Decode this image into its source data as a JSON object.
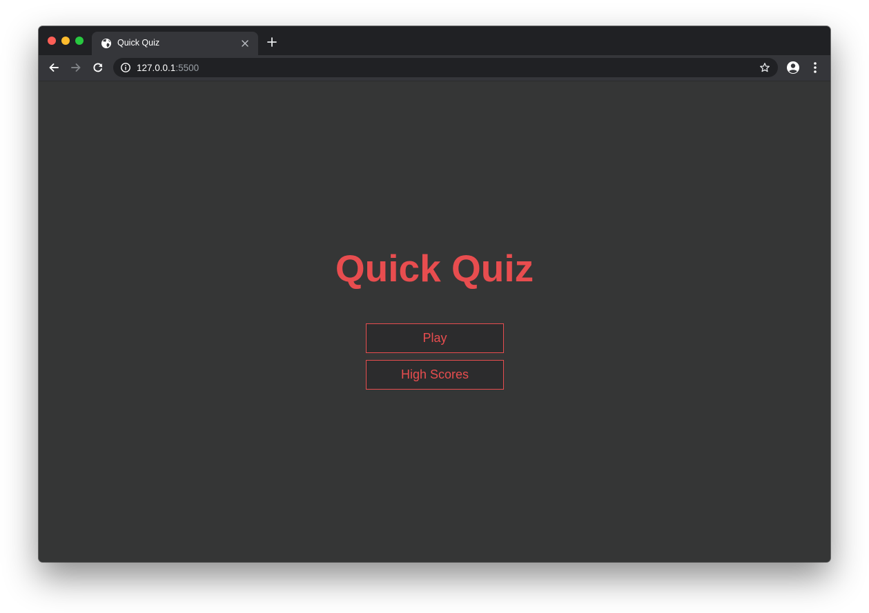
{
  "browser": {
    "tab": {
      "title": "Quick Quiz",
      "favicon": "globe-icon",
      "close_icon": "close-icon"
    },
    "new_tab_icon": "plus-icon",
    "toolbar": {
      "back_icon": "back-arrow-icon",
      "forward_icon": "forward-arrow-icon",
      "reload_icon": "reload-icon",
      "info_icon": "info-icon",
      "url_host": "127.0.0.1",
      "url_port": ":5500",
      "bookmark_icon": "star-icon",
      "profile_icon": "account-icon",
      "menu_icon": "kebab-menu-icon"
    }
  },
  "page": {
    "title": "Quick Quiz",
    "buttons": {
      "play": "Play",
      "high_scores": "High Scores"
    }
  },
  "colors": {
    "accent": "#e84d4f",
    "background": "#353636",
    "button_background": "#2c2c2d",
    "browser_frame": "#202124"
  }
}
